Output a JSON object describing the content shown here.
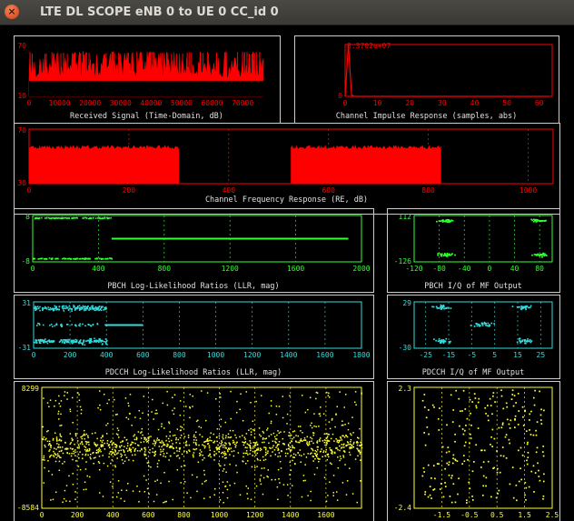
{
  "window": {
    "title": "LTE DL SCOPE eNB 0 to UE 0 CC_id 0",
    "close_glyph": "×"
  },
  "colors": {
    "red": "#ff0000",
    "green": "#33ff33",
    "cyan": "#33dddd",
    "yellow": "#ffff33",
    "frame": "#cccccc",
    "background": "#000000"
  },
  "chart_data": [
    {
      "id": "rx_signal",
      "type": "area",
      "title": "Received Signal (Time-Domain, dB)",
      "color": "red",
      "xlim": [
        0,
        78000
      ],
      "ylim": [
        10,
        70
      ],
      "xticks": [
        "0",
        "10000",
        "20000",
        "30000",
        "40000",
        "50000",
        "60000",
        "70000"
      ],
      "yticks": [
        "70",
        "10"
      ],
      "series": [
        {
          "x_range": [
            0,
            76800
          ],
          "y_low": 30,
          "y_high": 55,
          "y_peak": 62
        }
      ]
    },
    {
      "id": "chan_impulse",
      "type": "line",
      "title": "Channel Impulse Response (samples, abs)",
      "color": "red",
      "xlim": [
        0,
        64
      ],
      "ylim": [
        0,
        83702000
      ],
      "xticks": [
        "0",
        "10",
        "20",
        "30",
        "40",
        "50",
        "60"
      ],
      "yticks": [
        "8.3702e+07",
        "0"
      ],
      "series": [
        {
          "x": [
            0,
            1,
            2,
            3,
            4,
            63
          ],
          "y": [
            0,
            83702000,
            2000000,
            0,
            0,
            0
          ]
        }
      ]
    },
    {
      "id": "chan_freq",
      "type": "area",
      "title": "Channel Frequency Response (RE, dB)",
      "color": "red",
      "xlim": [
        0,
        1050
      ],
      "ylim": [
        30,
        70
      ],
      "xticks": [
        "0",
        "200",
        "400",
        "600",
        "800",
        "1000"
      ],
      "yticks": [
        "70",
        "30"
      ],
      "series": [
        {
          "x_range": [
            0,
            300
          ],
          "y_low": 30,
          "y_high": 57
        },
        {
          "x_range": [
            525,
            825
          ],
          "y_low": 30,
          "y_high": 57
        }
      ]
    },
    {
      "id": "pbch_llr",
      "type": "scatter",
      "title": "PBCH Log-Likelihood Ratios (LLR, mag)",
      "color": "green",
      "xlim": [
        0,
        2000
      ],
      "ylim": [
        -8,
        8
      ],
      "xticks": [
        "0",
        "400",
        "800",
        "1200",
        "1600",
        "2000"
      ],
      "yticks": [
        "8",
        "-8"
      ],
      "series": [
        {
          "name": "",
          "x_range": [
            0,
            480
          ],
          "levels": [
            7,
            -7
          ]
        },
        {
          "name": "",
          "x_range": [
            480,
            1920
          ],
          "levels": [
            0
          ]
        }
      ]
    },
    {
      "id": "pbch_iq",
      "type": "scatter",
      "title": "PBCH I/Q of MF Output",
      "color": "green",
      "xlim": [
        -120,
        100
      ],
      "ylim": [
        -126,
        112
      ],
      "xticks": [
        "-120",
        "-80",
        "-40",
        "0",
        "40",
        "80"
      ],
      "yticks": [
        "112",
        "-126"
      ],
      "clusters": [
        {
          "cx": -70,
          "cy": 85,
          "spread": 20
        },
        {
          "cx": -70,
          "cy": -90,
          "spread": 20
        },
        {
          "cx": 80,
          "cy": 85,
          "spread": 20
        },
        {
          "cx": 80,
          "cy": -90,
          "spread": 20
        }
      ]
    },
    {
      "id": "pdcch_llr",
      "type": "scatter",
      "title": "PDCCH Log-Likelihood Ratios (LLR, mag)",
      "color": "cyan",
      "xlim": [
        0,
        1800
      ],
      "ylim": [
        -31,
        31
      ],
      "xticks": [
        "0",
        "200",
        "400",
        "600",
        "800",
        "1000",
        "1200",
        "1400",
        "1600",
        "1800"
      ],
      "yticks": [
        "31",
        "-31"
      ],
      "series": [
        {
          "name": "",
          "x_range": [
            0,
            400
          ],
          "levels": [
            22,
            -22
          ]
        },
        {
          "name": "",
          "x_range": [
            400,
            600
          ],
          "levels": [
            0
          ]
        }
      ]
    },
    {
      "id": "pdcch_iq",
      "type": "scatter",
      "title": "PDCCH I/Q of MF Output",
      "color": "cyan",
      "xlim": [
        -30,
        30
      ],
      "ylim": [
        -30,
        29
      ],
      "xticks": [
        "-25",
        "-15",
        "-5",
        "5",
        "15",
        "25"
      ],
      "yticks": [
        "29",
        "-30"
      ],
      "clusters": [
        {
          "cx": -18,
          "cy": 22,
          "spread": 6
        },
        {
          "cx": -18,
          "cy": -21,
          "spread": 6
        },
        {
          "cx": 18,
          "cy": 22,
          "spread": 6
        },
        {
          "cx": 18,
          "cy": -21,
          "spread": 6
        },
        {
          "cx": 0,
          "cy": 0,
          "spread": 7
        }
      ]
    },
    {
      "id": "pdsch_llr",
      "type": "scatter",
      "title": "",
      "color": "yellow",
      "xlim": [
        0,
        1800
      ],
      "ylim": [
        -8584,
        8299
      ],
      "xticks": [
        "0",
        "200",
        "400",
        "600",
        "800",
        "1000",
        "1200",
        "1400",
        "1600"
      ],
      "yticks": [
        "8299",
        "-8584"
      ],
      "series": [
        {
          "name": "",
          "x_range": [
            0,
            1800
          ],
          "center": 0,
          "spread": 6500
        }
      ]
    },
    {
      "id": "pdsch_iq",
      "type": "scatter",
      "title": "",
      "color": "yellow",
      "xlim": [
        -2.5,
        2.5
      ],
      "ylim": [
        -2.4,
        2.3
      ],
      "xticks": [
        "-1.5",
        "-0.5",
        "0.5",
        "1.5",
        "2.5"
      ],
      "yticks": [
        "2.3",
        "-2.4"
      ],
      "clusters": [
        {
          "cx": 0,
          "cy": 0,
          "spread": 2.2
        }
      ]
    }
  ]
}
